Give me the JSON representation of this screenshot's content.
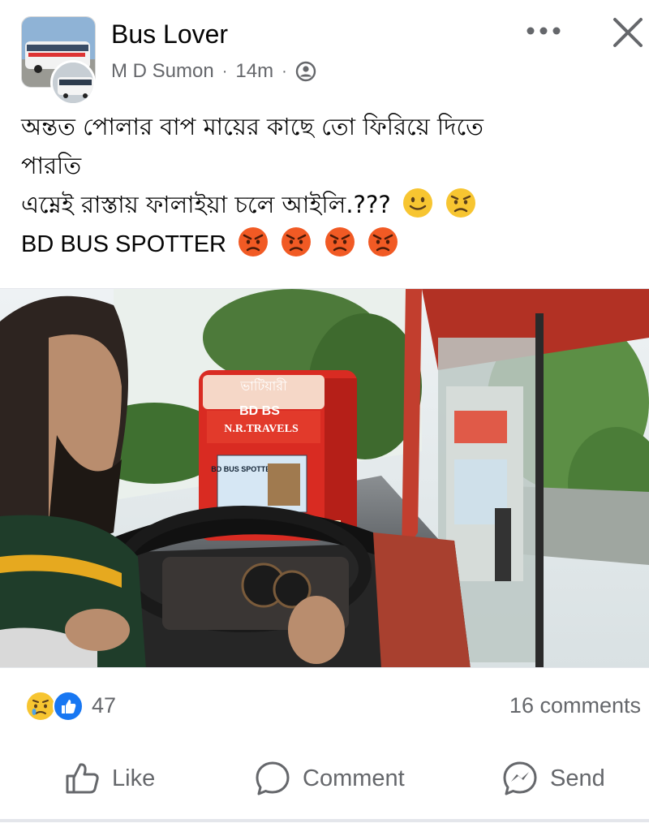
{
  "post": {
    "group_name": "Bus Lover",
    "author": "M D Sumon",
    "time": "14m",
    "separator": "·",
    "privacy_icon": "members-icon",
    "more_icon": "more-dots-icon",
    "close_icon": "close-icon"
  },
  "text": {
    "line1": "অন্তত পোলার বাপ মায়ের কাছে তো ফিরিয়ে দিতে",
    "line2": "পারতি",
    "line3": "এম্নেই রাস্তায় ফালাইয়া চলে আইলি.???",
    "line4": "BD BUS SPOTTER"
  },
  "photo_text": {
    "bus_company": "N.R.TRAVELS",
    "bus_dest": "ভাটিয়ারী",
    "bus_banner_top": "BD BS",
    "poster": "BD BUS SPOTTER"
  },
  "stats": {
    "reaction_count": "47",
    "comments": "16 comments"
  },
  "actions": {
    "like": "Like",
    "comment": "Comment",
    "send": "Send"
  },
  "colors": {
    "accent": "#1877f2",
    "muted": "#65676b",
    "bus_red": "#d92b22",
    "angry": "#f15a24"
  }
}
